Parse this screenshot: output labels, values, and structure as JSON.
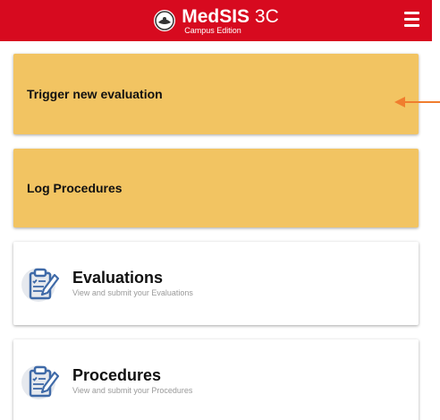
{
  "header": {
    "brand_bold": "MedSIS",
    "brand_suffix": " 3C",
    "edition": "Campus Edition",
    "bg_color": "#d70a1f",
    "menu_icon": "hamburger-icon"
  },
  "actions": [
    {
      "label": "Trigger new evaluation",
      "color": "#f2c462"
    },
    {
      "label": "Log Procedures",
      "color": "#f2c462"
    }
  ],
  "modules": [
    {
      "title": "Evaluations",
      "subtitle": "View and submit your Evaluations",
      "icon": "clipboard-pencil-icon"
    },
    {
      "title": "Procedures",
      "subtitle": "View and submit your Procedures",
      "icon": "clipboard-pencil-icon"
    }
  ],
  "annotation": {
    "icon": "arrow-left-icon",
    "color": "#f07d2e"
  }
}
